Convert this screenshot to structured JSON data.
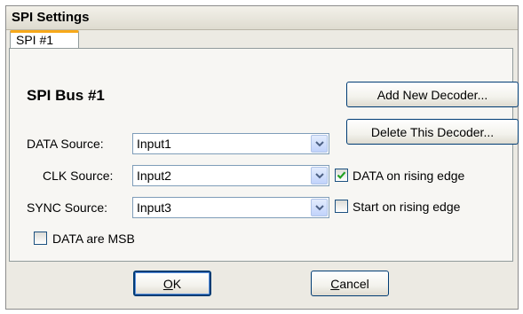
{
  "window": {
    "title": "SPI Settings"
  },
  "tabs": [
    {
      "label": "SPI #1",
      "selected": true
    }
  ],
  "panel": {
    "bus_title": "SPI Bus #1",
    "add_decoder_label": "Add New Decoder...",
    "delete_decoder_label": "Delete This Decoder...",
    "data_source": {
      "label": "DATA Source:",
      "value": "Input1"
    },
    "clk_source": {
      "label": "CLK Source:",
      "value": "Input2"
    },
    "sync_source": {
      "label": "SYNC Source:",
      "value": "Input3"
    },
    "data_rising": {
      "label": "DATA on rising edge",
      "checked": true
    },
    "start_rising": {
      "label": "Start on rising edge",
      "checked": false
    },
    "data_msb": {
      "label": "DATA are MSB",
      "checked": false
    }
  },
  "footer": {
    "ok_mnemonic": "O",
    "ok_rest": "K",
    "cancel_mnemonic": "C",
    "cancel_rest": "ancel"
  },
  "colors": {
    "check": "#21a121",
    "tab_accent": "#f7a91a"
  }
}
